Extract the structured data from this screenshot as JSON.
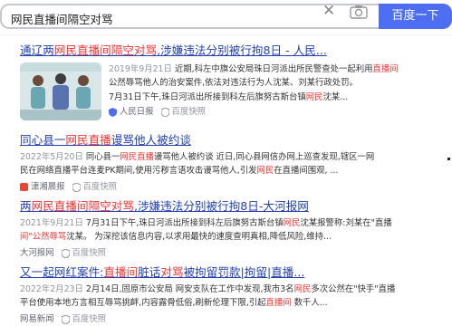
{
  "search": {
    "query": "网民直播间隔空对骂",
    "button_label": "百度一下"
  },
  "results": [
    {
      "title": [
        "通辽两",
        "网民直播间",
        "隔空对骂",
        ",涉嫌违法分别被行拘8日 - 人民..."
      ],
      "date": "2019年9月21日",
      "abstract_lines": [
        [
          "近期,科左中旗公安局珠日河派出所民警查处一起利用",
          "直播间",
          ""
        ],
        [
          "公然辱骂他人的治安案件,依法对违法行为人沈某、刘某行政处罚。",
          "",
          ""
        ],
        [
          "7月31日下午,珠日河派出所接到科左后旗努古斯台镇",
          "网民",
          "沈某..."
        ]
      ],
      "source": "人民日报",
      "snapshot": "百度快照"
    },
    {
      "title": [
        "同心县一",
        "网民直播",
        "谩骂他人被约谈",
        ""
      ],
      "date": "2022年5月20日",
      "abstract_lines": [
        [
          "同心县一",
          "网民直播",
          "谩骂他人被约谈 近日,同心县网信办网上巡查发现,辖区一网"
        ],
        [
          "民在网络直播平台连麦PK期间,使用污秽言语攻击谩骂他人,引发",
          "网民",
          "在直播间围观, ..."
        ]
      ],
      "source": "潇湘晨报",
      "snapshot": "百度快照"
    },
    {
      "title": [
        "两",
        "网民直播间",
        "隔空对骂",
        ",涉嫌违法分别被行拘8日-大河报网"
      ],
      "date": "2021年9月21日",
      "abstract_lines": [
        [
          "7月31日下午,珠日河派出所接到科左后旗努古斯台镇",
          "网民",
          "沈某报警称:刘某在\"直播"
        ],
        [
          "间\"",
          "公然辱骂",
          "沈某。 为深挖该信息内容,以求用最快的速度查明真相,降低风险,维持..."
        ]
      ],
      "source": "大河报网",
      "snapshot": "百度快照"
    },
    {
      "title": [
        "又一起网红案件:",
        "直播间",
        "脏话",
        "对骂",
        "被拘留罚款|拘留|直播..."
      ],
      "date": "2022年2月23日",
      "abstract_lines": [
        [
          "2月14日,固原市公安局 网安支队在工作中发现,我市3名",
          "网民",
          "多次公然在\"快手\"直播"
        ],
        [
          "平台使用本地方言相互辱骂挑衅,内容露骨低俗,刷新伦理下限,引起",
          "直播间",
          " 数千人..."
        ]
      ],
      "source": "网易新闻",
      "snapshot": "百度快照"
    }
  ]
}
